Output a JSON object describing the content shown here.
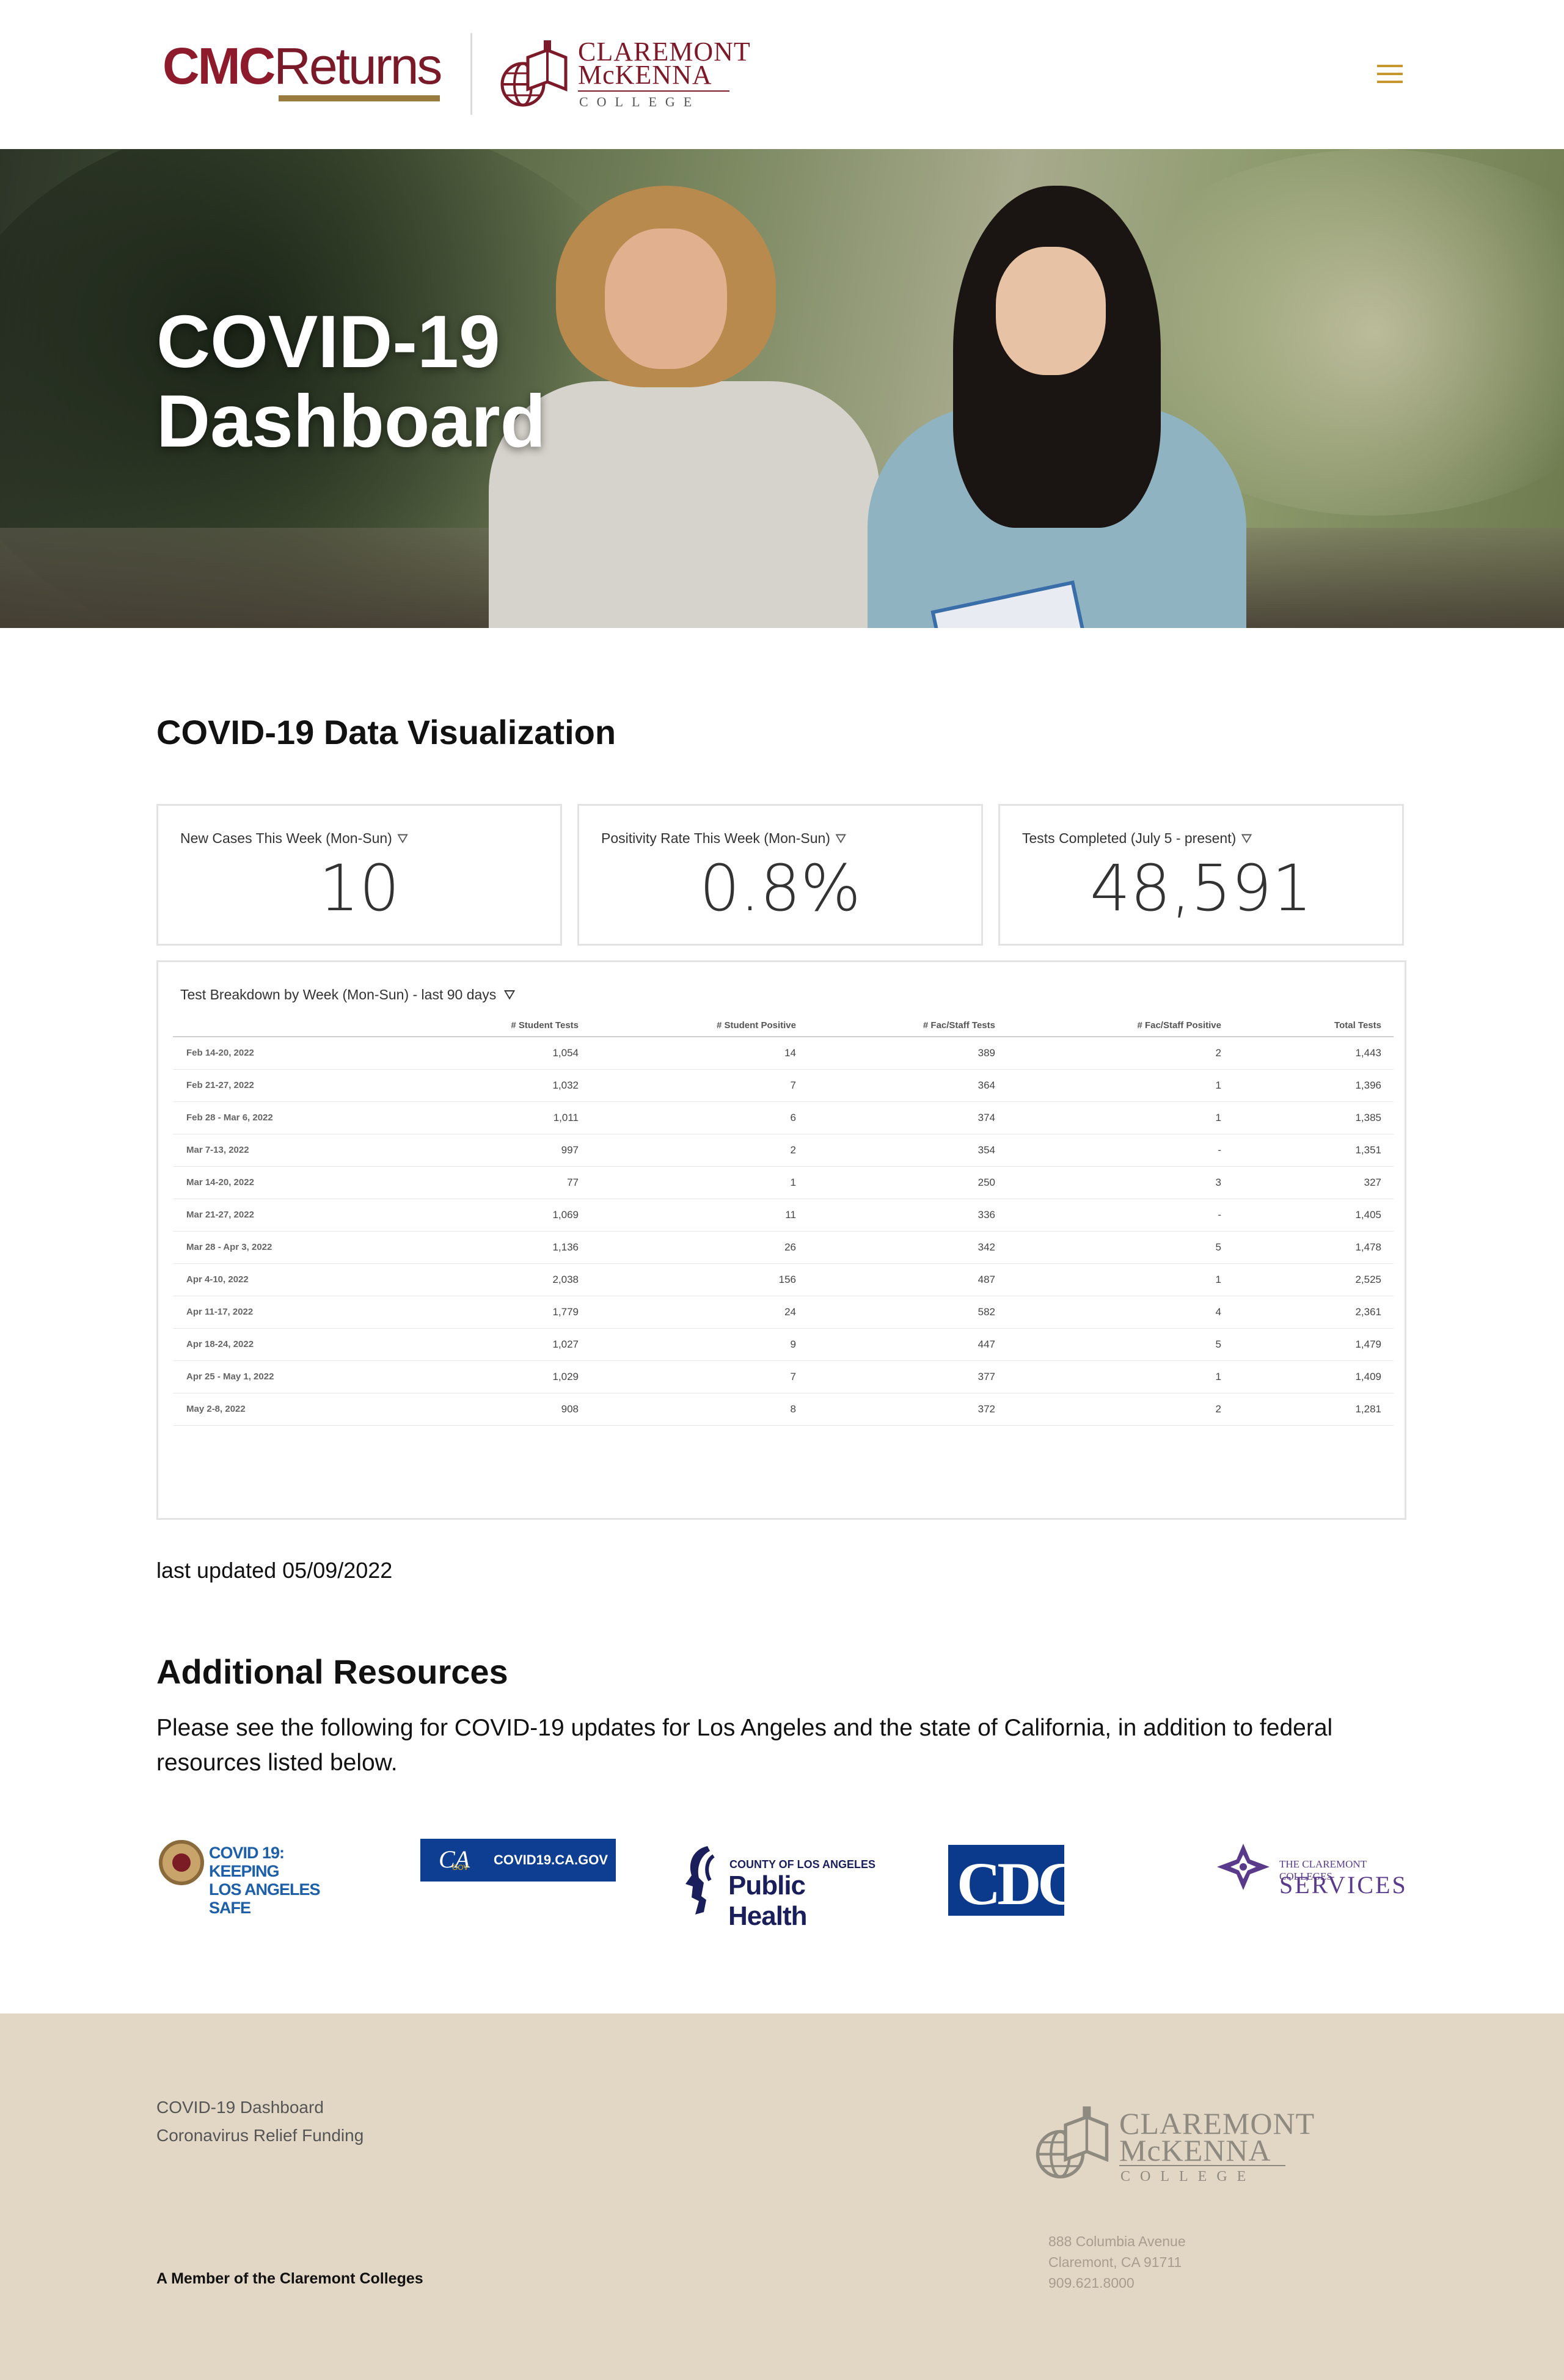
{
  "header": {
    "logo_cmc_part1": "CMC",
    "logo_cmc_part2": "Returns",
    "college_name_line1": "CLAREMONT",
    "college_name_line2": "McKENNA",
    "college_sub": "COLLEGE",
    "menu_icon": "hamburger-icon"
  },
  "hero": {
    "title_line1": "COVID-19",
    "title_line2": "Dashboard"
  },
  "main": {
    "section_title": "COVID-19 Data Visualization",
    "kpis": [
      {
        "label": "New Cases This Week (Mon-Sun)",
        "value": "10"
      },
      {
        "label": "Positivity Rate This Week (Mon-Sun)",
        "value": "0.8%"
      },
      {
        "label": "Tests Completed (July 5 - present)",
        "value": "48,591"
      }
    ],
    "filter_icon": "filter-icon",
    "table": {
      "title": "Test Breakdown by Week (Mon-Sun) - last 90 days",
      "columns": [
        "",
        "# Student Tests",
        "# Student Positive",
        "# Fac/Staff Tests",
        "# Fac/Staff Positive",
        "Total Tests"
      ],
      "rows": [
        [
          "Feb 14-20, 2022",
          "1,054",
          "14",
          "389",
          "2",
          "1,443"
        ],
        [
          "Feb 21-27, 2022",
          "1,032",
          "7",
          "364",
          "1",
          "1,396"
        ],
        [
          "Feb 28 - Mar 6, 2022",
          "1,011",
          "6",
          "374",
          "1",
          "1,385"
        ],
        [
          "Mar 7-13, 2022",
          "997",
          "2",
          "354",
          "-",
          "1,351"
        ],
        [
          "Mar 14-20, 2022",
          "77",
          "1",
          "250",
          "3",
          "327"
        ],
        [
          "Mar 21-27, 2022",
          "1,069",
          "11",
          "336",
          "-",
          "1,405"
        ],
        [
          "Mar 28 - Apr 3, 2022",
          "1,136",
          "26",
          "342",
          "5",
          "1,478"
        ],
        [
          "Apr 4-10, 2022",
          "2,038",
          "156",
          "487",
          "1",
          "2,525"
        ],
        [
          "Apr 11-17, 2022",
          "1,779",
          "24",
          "582",
          "4",
          "2,361"
        ],
        [
          "Apr 18-24, 2022",
          "1,027",
          "9",
          "447",
          "5",
          "1,479"
        ],
        [
          "Apr 25 - May 1, 2022",
          "1,029",
          "7",
          "377",
          "1",
          "1,409"
        ],
        [
          "May 2-8, 2022",
          "908",
          "8",
          "372",
          "2",
          "1,281"
        ]
      ]
    },
    "last_updated": "last updated 05/09/2022",
    "resources_title": "Additional Resources",
    "resources_text": "Please see the following for COVID-19 updates for  Los Angeles and the state of California, in addition to federal resources listed below.",
    "resource_logos": {
      "la_line1": "COVID 19: KEEPING",
      "la_line2": "LOS ANGELES SAFE",
      "ca_gov": "CA",
      "ca_gov_small": "GOV",
      "ca_text": "COVID19.CA.GOV",
      "ph_line1": "COUNTY OF LOS ANGELES",
      "ph_line2": "Public Health",
      "cdc": "CDC",
      "tcc_line1": "THE CLAREMONT COLLEGES",
      "tcc_line2": "SERVICES"
    }
  },
  "footer": {
    "links": [
      "COVID-19 Dashboard",
      "Coronavirus Relief Funding"
    ],
    "member": "A Member of the Claremont Colleges",
    "college_name_line1": "CLAREMONT",
    "college_name_line2": "McKENNA",
    "college_sub": "COLLEGE",
    "address_line1": "888 Columbia Avenue",
    "address_line2": "Claremont, CA 91711",
    "phone": "909.621.8000"
  },
  "colors": {
    "cmc_red": "#8e1b2c",
    "gold": "#9a7b3f",
    "menu_gold": "#c8962e",
    "footer_bg": "#e2d7c5"
  }
}
